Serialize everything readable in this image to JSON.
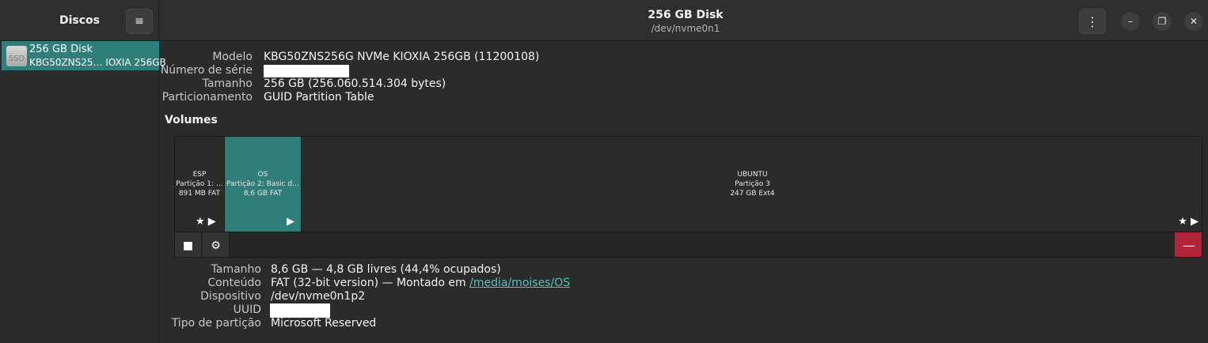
{
  "sidebar": {
    "title": "Discos",
    "menu_icon": "≡",
    "disks": [
      {
        "name": "256 GB Disk",
        "model": "KBG50ZNS25… IOXIA 256GB",
        "icon_text": "SSD"
      }
    ]
  },
  "header": {
    "title": "256 GB Disk",
    "subtitle": "/dev/nvme0n1",
    "kebab_icon": "⋮",
    "minimize_icon": "–",
    "maximize_icon": "❐",
    "close_icon": "✕"
  },
  "disk_info": {
    "model_label": "Modelo",
    "model_value": "KBG50ZNS256G NVMe KIOXIA 256GB (11200108)",
    "serial_label": "Número de série",
    "serial_value": "",
    "size_label": "Tamanho",
    "size_value": "256 GB (256.060.514.304 bytes)",
    "partitioning_label": "Particionamento",
    "partitioning_value": "GUID Partition Table"
  },
  "volumes": {
    "title": "Volumes",
    "partitions": [
      {
        "name": "ESP",
        "desc": "Partição 1: …",
        "size": "891 MB FAT",
        "star": "★",
        "play": "▶"
      },
      {
        "name": "OS",
        "desc": "Partição 2: Basic d…",
        "size": "8,6 GB FAT",
        "play": "▶"
      },
      {
        "name": "UBUNTU",
        "desc": "Partição 3",
        "size": "247 GB Ext4",
        "star": "★",
        "play": "▶"
      }
    ],
    "toolbar": {
      "stop_icon": "■",
      "gear_icon": "⚙",
      "delete_icon": "—"
    }
  },
  "selected_volume": {
    "size_label": "Tamanho",
    "size_value": "8,6 GB — 4,8 GB livres (44,4% ocupados)",
    "content_label": "Conteúdo",
    "content_value": "FAT (32-bit version) — Montado em",
    "mount_link": "/media/moises/OS",
    "device_label": "Dispositivo",
    "device_value": "/dev/nvme0n1p2",
    "uuid_label": "UUID",
    "uuid_value": "",
    "parttype_label": "Tipo de partição",
    "parttype_value": "Microsoft Reserved"
  }
}
